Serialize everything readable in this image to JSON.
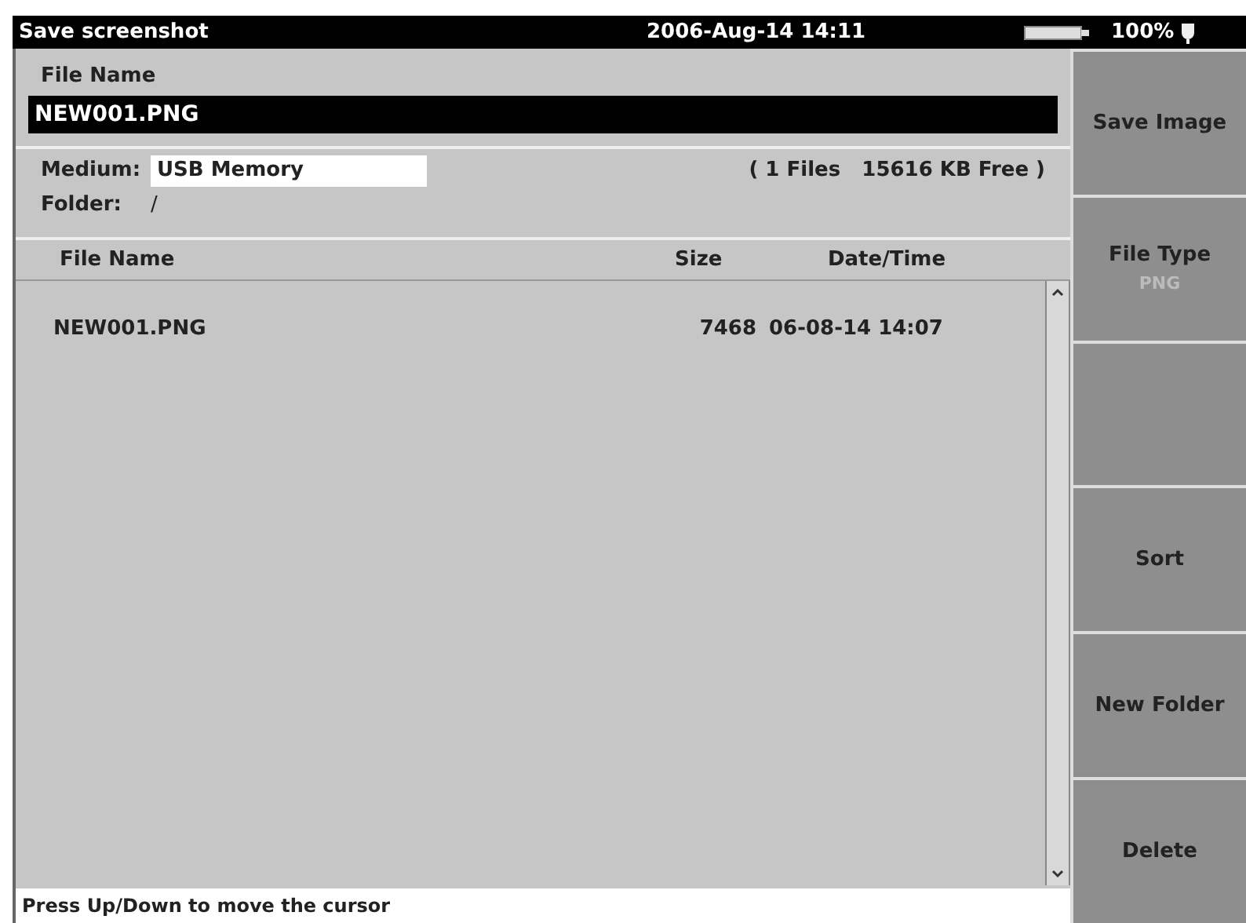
{
  "title_bar": {
    "title": "Save screenshot",
    "datetime": "2006-Aug-14 14:11",
    "battery": "100%"
  },
  "file_name": {
    "label": "File Name",
    "value": "NEW001.PNG"
  },
  "medium": {
    "label": "Medium:",
    "value": "USB Memory",
    "summary": "( 1 Files   15616 KB Free )"
  },
  "folder": {
    "label": "Folder:",
    "value": "/"
  },
  "table": {
    "columns": [
      "File Name",
      "Size",
      "Date/Time"
    ],
    "rows": [
      {
        "cells": [
          "NEW001.PNG",
          "7468",
          "06-08-14 14:07"
        ]
      }
    ]
  },
  "softkeys": [
    {
      "kind": "key",
      "label": "Save Image"
    },
    {
      "kind": "key",
      "label": "File Type",
      "value": "PNG"
    },
    {
      "kind": "empty"
    },
    {
      "kind": "key",
      "label": "Sort"
    },
    {
      "kind": "key",
      "label": "New Folder"
    },
    {
      "kind": "key",
      "label": "Delete"
    }
  ],
  "status_bar": "Press Up/Down to move the cursor"
}
